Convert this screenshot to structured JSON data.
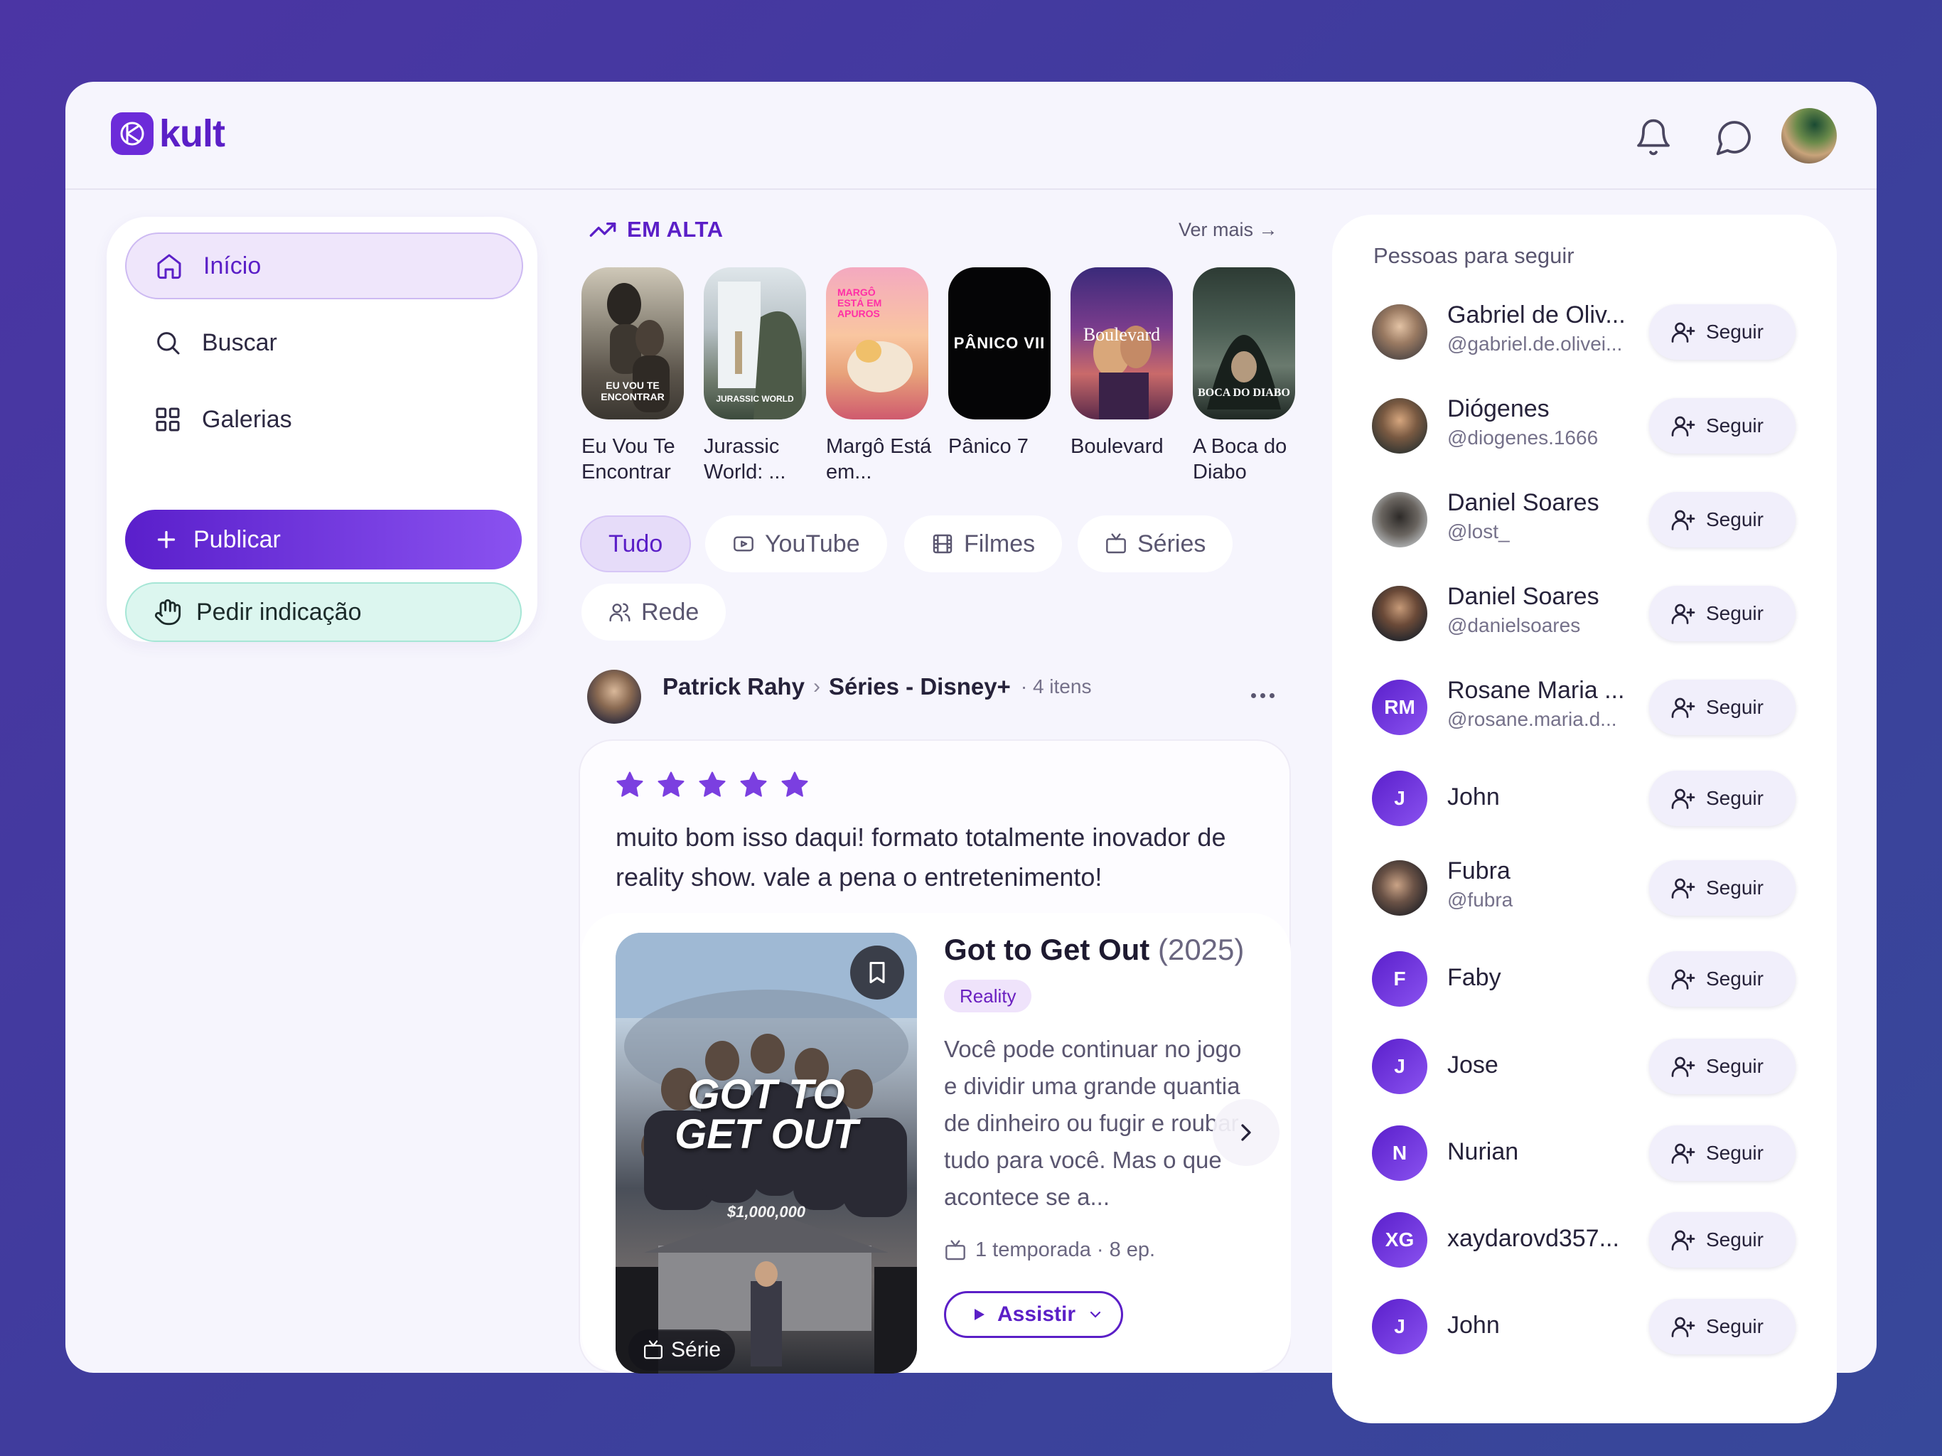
{
  "app": {
    "logo_text": "kult"
  },
  "topbar": {
    "icons": [
      "bell-icon",
      "message-circle-icon"
    ]
  },
  "nav": {
    "items": [
      {
        "label": "Início",
        "icon": "home-icon",
        "active": true
      },
      {
        "label": "Buscar",
        "icon": "search-icon",
        "active": false
      },
      {
        "label": "Galerias",
        "icon": "grid-icon",
        "active": false
      }
    ],
    "publish_label": "Publicar",
    "request_label": "Pedir indicação"
  },
  "trending": {
    "title": "EM ALTA",
    "more_label": "Ver mais →",
    "items": [
      {
        "title": "Eu Vou Te Encontrar",
        "poster_text": "EU VOU TE ENCONTRAR"
      },
      {
        "title": "Jurassic World: ...",
        "poster_text": "JURASSIC WORLD"
      },
      {
        "title": "Margô Está em...",
        "poster_text": "MARGÔ ESTÁ EM APUROS"
      },
      {
        "title": "Pânico 7",
        "poster_text": "PÂNICO VII"
      },
      {
        "title": "Boulevard",
        "poster_text": "Boulevard"
      },
      {
        "title": "A Boca do Diabo",
        "poster_text": "BOCA DO DIABO"
      }
    ]
  },
  "filters": [
    {
      "label": "Tudo",
      "icon": "",
      "active": true
    },
    {
      "label": "YouTube",
      "icon": "youtube-icon",
      "active": false
    },
    {
      "label": "Filmes",
      "icon": "film-icon",
      "active": false
    },
    {
      "label": "Séries",
      "icon": "tv-icon",
      "active": false
    },
    {
      "label": "Rede",
      "icon": "users-icon",
      "active": false
    }
  ],
  "post": {
    "author": "Patrick Rahy",
    "separator": "›",
    "gallery": "Séries - Disney+",
    "count": "· 4 itens",
    "rating": 5,
    "text": "muito bom isso daqui! formato totalmente inovador de reality show. vale a pena o entretenimento!",
    "media": {
      "title": "Got to Get Out",
      "year": "(2025)",
      "genre": "Reality",
      "synopsis": "Você pode continuar no jogo e dividir uma grande quantia de dinheiro ou fugir e roubar tudo para você. Mas o que acontece se a...",
      "seasons": "1 temporada · 8 ep.",
      "watch_label": "Assistir",
      "type_badge": "Série",
      "poster_line1": "GOT TO",
      "poster_line2": "GET OUT",
      "poster_amount": "$1,000,000"
    }
  },
  "people": {
    "title": "Pessoas para seguir",
    "follow_label": "Seguir",
    "list": [
      {
        "name": "Gabriel de Oliv...",
        "handle": "@gabriel.de.olivei...",
        "initials": ""
      },
      {
        "name": "Diógenes",
        "handle": "@diogenes.1666",
        "initials": ""
      },
      {
        "name": "Daniel Soares",
        "handle": "@lost_",
        "initials": ""
      },
      {
        "name": "Daniel Soares",
        "handle": "@danielsoares",
        "initials": ""
      },
      {
        "name": "Rosane Maria ...",
        "handle": "@rosane.maria.d...",
        "initials": "RM"
      },
      {
        "name": "John",
        "handle": "",
        "initials": "J"
      },
      {
        "name": "Fubra",
        "handle": "@fubra",
        "initials": ""
      },
      {
        "name": "Faby",
        "handle": "",
        "initials": "F"
      },
      {
        "name": "Jose",
        "handle": "",
        "initials": "J"
      },
      {
        "name": "Nurian",
        "handle": "",
        "initials": "N"
      },
      {
        "name": "xaydarovd357...",
        "handle": "",
        "initials": "XG"
      },
      {
        "name": "John",
        "handle": "",
        "initials": "J"
      }
    ]
  },
  "colors": {
    "brand": "#5b1fc7",
    "accent_gradient_start": "#5a1fcb",
    "accent_gradient_end": "#8a52f0",
    "request_bg": "#dcf6ef"
  }
}
